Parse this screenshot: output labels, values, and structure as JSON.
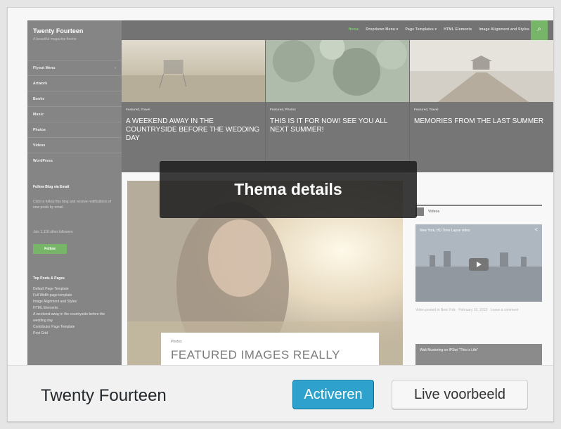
{
  "theme_card": {
    "name": "Twenty Fourteen",
    "overlay_label": "Thema details",
    "activate_label": "Activeren",
    "preview_label": "Live voorbeeld"
  },
  "preview": {
    "site_title": "Twenty Fourteen",
    "site_description": "A beautiful magazine theme",
    "sidebar_menu": [
      "Flyout Menu",
      "Artwork",
      "Books",
      "Music",
      "Photos",
      "Videos",
      "WordPress"
    ],
    "widget_title": "Follow Blog via Email",
    "widget_text": "Click to follow this blog and receive notifications of new posts by email.",
    "join_text": "Join 1,118 other followers",
    "follow_label": "Follow",
    "top_posts_title": "Top Posts & Pages",
    "top_posts": [
      "Default Page Template",
      "Full Width page template",
      "Image Alignment and Styles",
      "HTML Elements",
      "A weekend away in the countryside before the wedding day",
      "Contributor Page Template",
      "Post Grid"
    ],
    "nav": [
      "Home",
      "Dropdown Menu ▾",
      "Page Templates ▾",
      "HTML Elements",
      "Image Alignment and Styles"
    ],
    "featured": [
      {
        "category": "Featured, Travel",
        "title": "A weekend away in the countryside before the wedding day"
      },
      {
        "category": "Featured, Photos",
        "title": "This is it for now! See you all next summer!"
      },
      {
        "category": "Featured, Travel",
        "title": "Memories from the last summer"
      }
    ],
    "post": {
      "category": "Photos",
      "title": "FEATURED IMAGES REALLY"
    },
    "videos_label": "Videos",
    "video1_title": "New York, HD Time Lapse video",
    "video_meta": "Video posted in New York · February 10, 2013 · Leave a comment",
    "video2_title": "Walt Mustering on IPSwi \"This is Life\""
  },
  "colors": {
    "activate_bg": "#2ea2cc",
    "accent_green": "#24890d",
    "overlay_bg": "#202020"
  }
}
